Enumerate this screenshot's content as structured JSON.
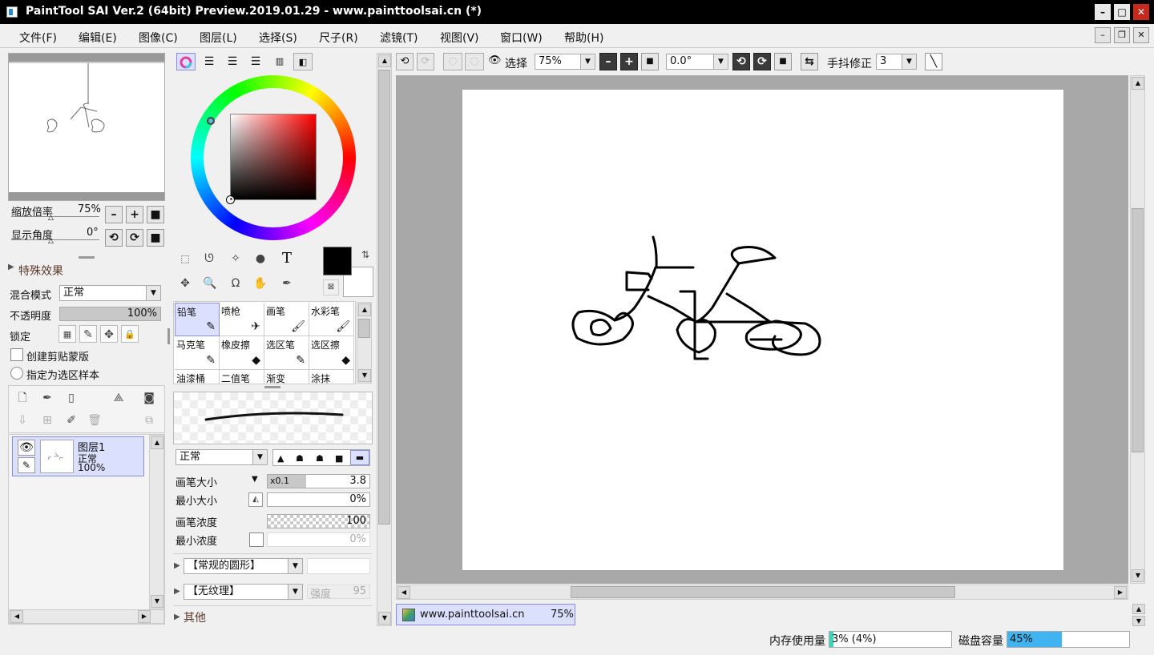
{
  "title": "PaintTool SAI Ver.2 (64bit) Preview.2019.01.29 - www.painttoolsai.cn (*)",
  "window_buttons": {
    "minimize": "–",
    "maximize": "□",
    "close": "✕"
  },
  "menu": [
    "文件(F)",
    "编辑(E)",
    "图像(C)",
    "图层(L)",
    "选择(S)",
    "尺子(R)",
    "滤镜(T)",
    "视图(V)",
    "窗口(W)",
    "帮助(H)"
  ],
  "mdi_buttons": {
    "minimize": "–",
    "restore": "❐",
    "close": "✕"
  },
  "navigator": {
    "zoom_label": "缩放倍率",
    "zoom_value": "75%",
    "angle_label": "显示角度",
    "angle_value": "0°"
  },
  "layer_panel": {
    "effects_label": "特殊效果",
    "blend_label": "混合模式",
    "blend_value": "正常",
    "opacity_label": "不透明度",
    "opacity_value": "100%",
    "opacity": 1.0,
    "lock_label": "锁定",
    "clip_label": "创建剪贴蒙版",
    "sample_label": "指定为选区样本",
    "layer": {
      "name": "图层1",
      "mode": "正常",
      "opacity": "100%"
    }
  },
  "color": {
    "fg": "#000000",
    "bg": "#ffffff"
  },
  "text_tool_glyph": "T",
  "brushes": [
    {
      "name": "铅笔",
      "icon": "✎",
      "selected": true
    },
    {
      "name": "喷枪",
      "icon": "✈",
      "selected": false
    },
    {
      "name": "画笔",
      "icon": "🖌",
      "selected": false
    },
    {
      "name": "水彩笔",
      "icon": "🖌",
      "selected": false
    },
    {
      "name": "马克笔",
      "icon": "✎",
      "selected": false
    },
    {
      "name": "橡皮擦",
      "icon": "◆",
      "selected": false
    },
    {
      "name": "选区笔",
      "icon": "✎",
      "selected": false
    },
    {
      "name": "选区擦",
      "icon": "◆",
      "selected": false
    },
    {
      "name": "油漆桶",
      "icon": "",
      "selected": false
    },
    {
      "name": "二值笔",
      "icon": "",
      "selected": false
    },
    {
      "name": "渐变",
      "icon": "",
      "selected": false
    },
    {
      "name": "涂抹",
      "icon": "",
      "selected": false
    }
  ],
  "brush_settings": {
    "mode": "正常",
    "size_label": "画笔大小",
    "size_mult": "x0.1",
    "size_value": "3.8",
    "min_size_label": "最小大小",
    "min_size_value": "0%",
    "density_label": "画笔浓度",
    "density_value": "100",
    "min_density_label": "最小浓度",
    "min_density_value": "0%",
    "shape": "【常规的圆形】",
    "texture": "【无纹理】",
    "strength_label": "强度",
    "strength_value": "95",
    "other_label": "其他"
  },
  "canvas_toolbar": {
    "select_label": "选择",
    "zoom": "75%",
    "angle": "0.0°",
    "stabilizer_label": "手抖修正",
    "stabilizer": "3"
  },
  "document_tab": {
    "name": "www.painttoolsai.cn",
    "zoom": "75%"
  },
  "status": {
    "mem_label": "内存使用量",
    "mem_value": "3% (4%)",
    "mem_fraction": 0.03,
    "disk_label": "磁盘容量",
    "disk_value": "45%",
    "disk_fraction": 0.45
  },
  "colors": {
    "accent": "#4fb0f0",
    "selection": "#dce0ff",
    "mem_fill": "#3dd6b8",
    "disk_fill": "#3fb4f0"
  }
}
